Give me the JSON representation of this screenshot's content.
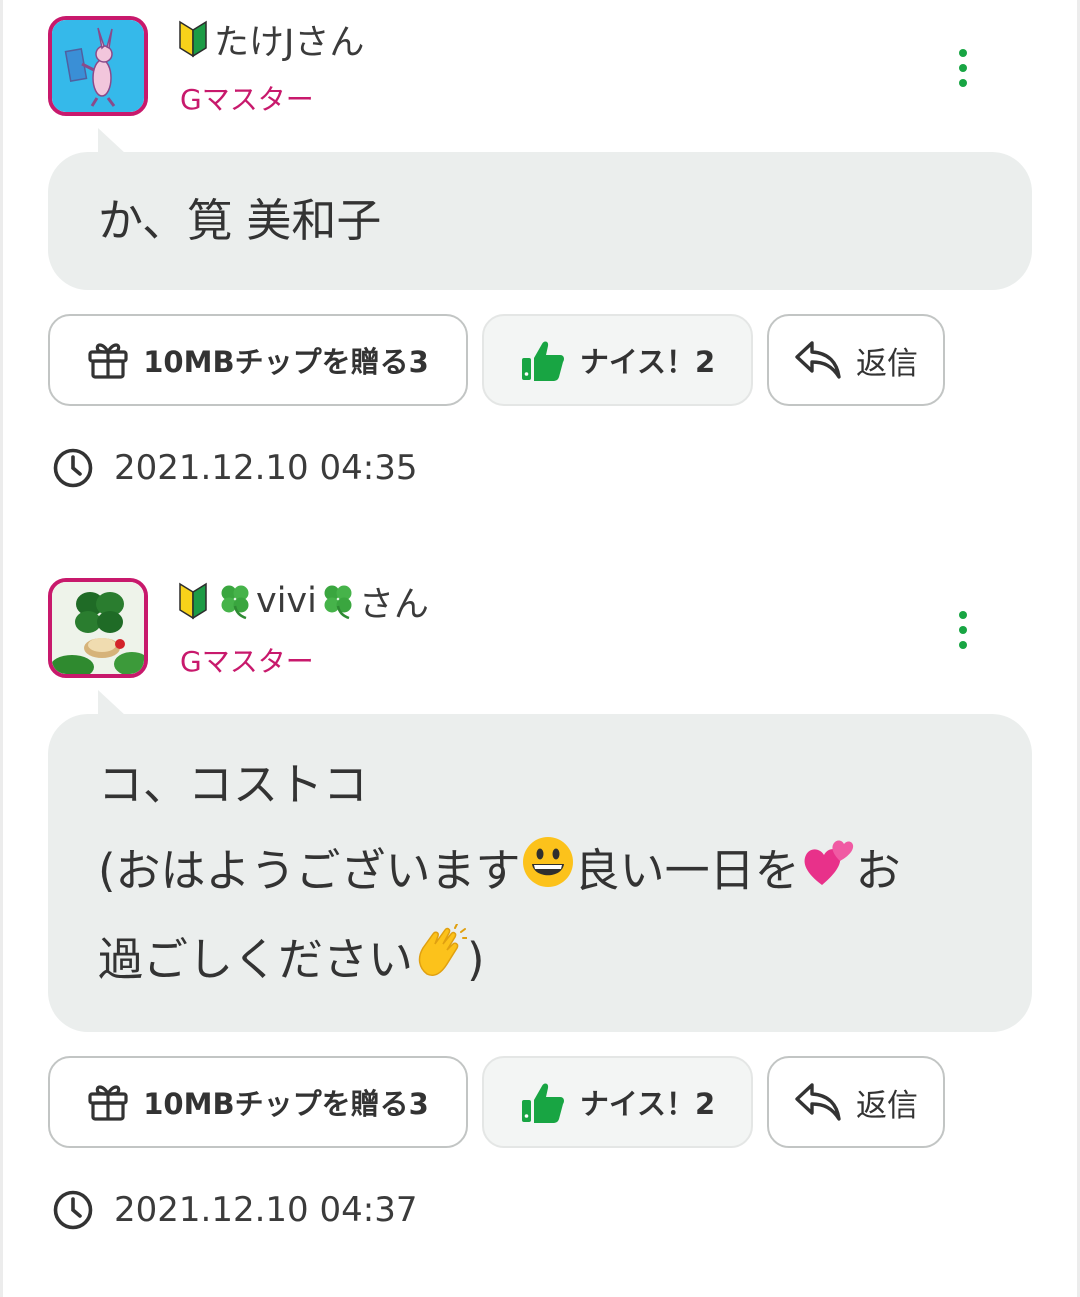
{
  "comments": [
    {
      "user_name": "たけJさん",
      "rank": "Gマスター",
      "message_lines": [
        "か、筧 美和子"
      ],
      "tip_button_label": "10MBチップを贈る3",
      "nice_button_label": "ナイス！2",
      "reply_button_label": "返信",
      "timestamp": "2021.12.10 04:35",
      "icons": [
        "beginner-mark-icon",
        "more-vertical-icon",
        "gift-icon",
        "thumbs-up-icon",
        "reply-icon",
        "clock-icon"
      ]
    },
    {
      "user_name_parts": [
        "vivi",
        "さん"
      ],
      "rank": "Gマスター",
      "message_lines": [
        "コ、コストコ",
        "(おはようございます",
        "良い一日を",
        "お",
        "過ごしください",
        ")"
      ],
      "tip_button_label": "10MBチップを贈る3",
      "nice_button_label": "ナイス！2",
      "reply_button_label": "返信",
      "timestamp": "2021.12.10 04:37",
      "icons": [
        "beginner-mark-icon",
        "four-leaf-clover-icon",
        "more-vertical-icon",
        "grinning-face-icon",
        "two-hearts-icon",
        "clapping-hands-icon"
      ]
    }
  ],
  "colors": {
    "accent_green": "#18a543",
    "rank_pink": "#c8196c",
    "bubble_bg": "#ebeeed"
  }
}
